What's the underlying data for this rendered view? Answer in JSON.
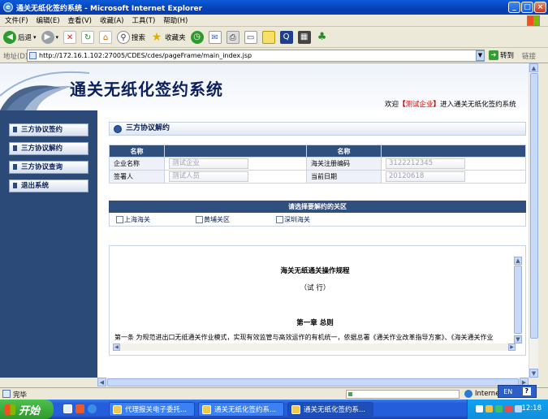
{
  "window": {
    "title": "通关无纸化签约系统 - Microsoft Internet Explorer",
    "minimize": "_",
    "maximize": "□",
    "close": "×"
  },
  "menu": [
    "文件(F)",
    "编辑(E)",
    "查看(V)",
    "收藏(A)",
    "工具(T)",
    "帮助(H)"
  ],
  "toolbar": {
    "back": "后退",
    "search": "搜索",
    "favorites": "收藏夹"
  },
  "address": {
    "label": "地址(D)",
    "url": "http://172.16.1.102:27005/CDES/cdes/pageFrame/main_index.jsp",
    "go": "转到",
    "links": "链接"
  },
  "header": {
    "system_title": "通关无纸化签约系统",
    "welcome_prefix": "欢迎",
    "bracket_open": "【",
    "user_name": "测试企业",
    "bracket_close": "】",
    "welcome_suffix": "进入通关无纸化签约系统"
  },
  "sidebar": {
    "items": [
      {
        "label": "三方协议签约"
      },
      {
        "label": "三方协议解约"
      },
      {
        "label": "三方协议查询"
      },
      {
        "label": "退出系统"
      }
    ]
  },
  "section": {
    "title": "三方协议解约"
  },
  "info_table": {
    "header_left": "名称",
    "header_right": "名称",
    "rows": [
      {
        "label1": "企业名称",
        "value1": "测试企业",
        "label2": "海关注册编码",
        "value2": "3122212345"
      },
      {
        "label1": "签署人",
        "value1": "测试人员",
        "label2": "当前日期",
        "value2": "20120618"
      }
    ]
  },
  "ports": {
    "title": "请选择要解约的关区",
    "options": [
      "上海海关",
      "黄埔关区",
      "深圳海关"
    ]
  },
  "rules": {
    "title": "海关无纸通关操作规程",
    "subtitle": "（试 行）",
    "chapter": "第一章  总则",
    "article": "第一条  为规范进出口无纸通关作业模式，实现有效监管与高效运作的有机统一，依据总署《通关作业改革指导方案》、《海关通关作业"
  },
  "status": {
    "text": "完毕",
    "zone": "Internet",
    "lang": "EN",
    "help": "?"
  },
  "taskbar": {
    "start": "开始",
    "tasks": [
      "代理报关电子委托...",
      "通关无纸化签约系...",
      "通关无纸化签约系..."
    ],
    "clock": "12:18"
  }
}
